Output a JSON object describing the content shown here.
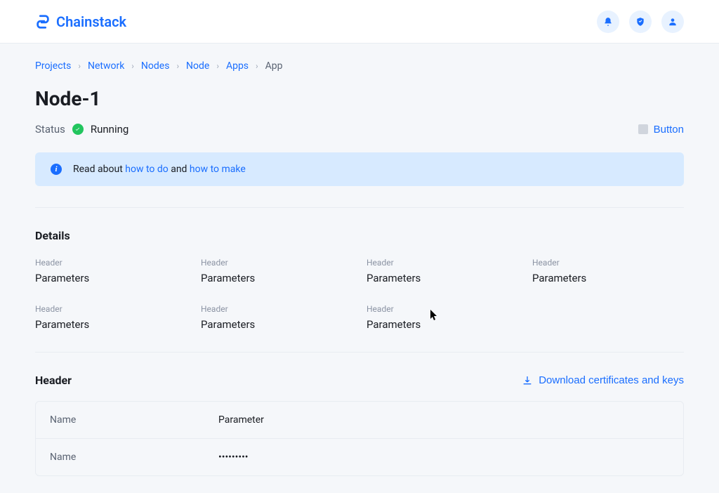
{
  "brand": "Chainstack",
  "breadcrumbs": [
    {
      "label": "Projects",
      "link": true
    },
    {
      "label": "Network",
      "link": true
    },
    {
      "label": "Nodes",
      "link": true
    },
    {
      "label": "Node",
      "link": true
    },
    {
      "label": "Apps",
      "link": true
    },
    {
      "label": "App",
      "link": false
    }
  ],
  "page_title": "Node-1",
  "status": {
    "label": "Status",
    "value": "Running"
  },
  "action_button": "Button",
  "banner": {
    "prefix": "Read about ",
    "link1": "how to do",
    "mid": " and ",
    "link2": "how to make"
  },
  "details": {
    "title": "Details",
    "items": [
      {
        "label": "Header",
        "value": "Parameters"
      },
      {
        "label": "Header",
        "value": "Parameters"
      },
      {
        "label": "Header",
        "value": "Parameters"
      },
      {
        "label": "Header",
        "value": "Parameters"
      },
      {
        "label": "Header",
        "value": "Parameters"
      },
      {
        "label": "Header",
        "value": "Parameters"
      },
      {
        "label": "Header",
        "value": "Parameters"
      }
    ]
  },
  "cert_section": {
    "title": "Header",
    "download_label": "Download certificates and keys",
    "rows": [
      {
        "name": "Name",
        "value": "Parameter"
      },
      {
        "name": "Name",
        "value": "•••••••••"
      }
    ]
  }
}
